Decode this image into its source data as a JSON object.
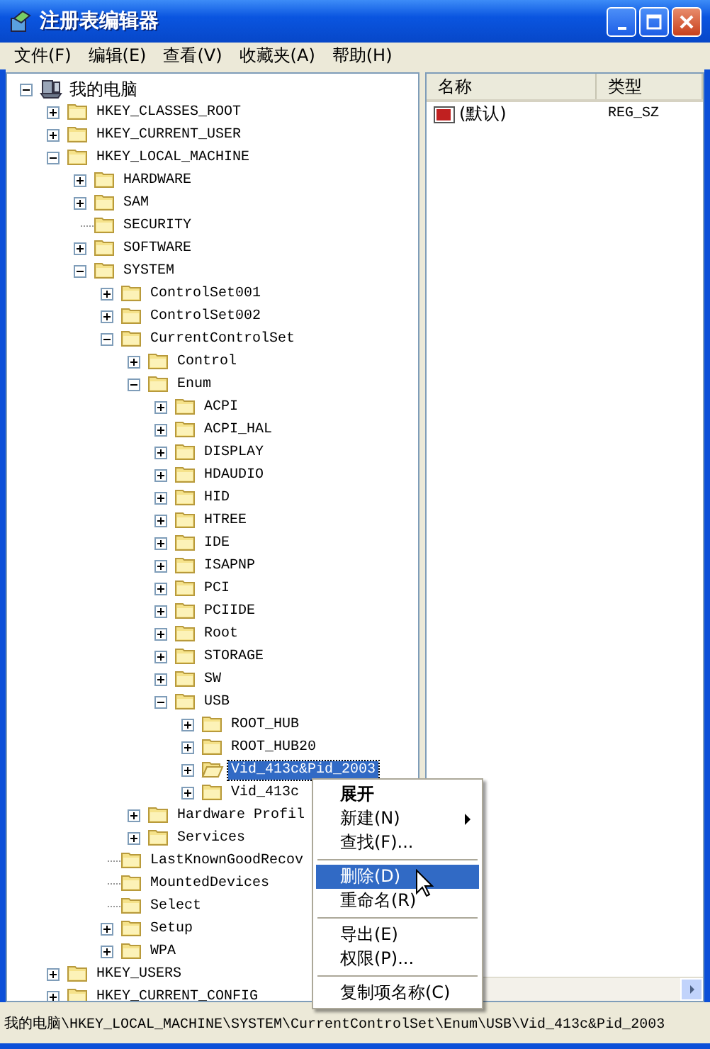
{
  "window": {
    "title": "注册表编辑器"
  },
  "menu_bar": [
    {
      "label": "文件(F)"
    },
    {
      "label": "编辑(E)"
    },
    {
      "label": "查看(V)"
    },
    {
      "label": "收藏夹(A)"
    },
    {
      "label": "帮助(H)"
    }
  ],
  "tree": [
    {
      "label": "我的电脑",
      "kind": "computer",
      "expanded": true,
      "selected": false,
      "children": [
        {
          "label": "HKEY_CLASSES_ROOT",
          "expanded": false,
          "selected": false
        },
        {
          "label": "HKEY_CURRENT_USER",
          "expanded": false,
          "selected": false
        },
        {
          "label": "HKEY_LOCAL_MACHINE",
          "expanded": true,
          "selected": false,
          "children": [
            {
              "label": "HARDWARE",
              "expanded": false,
              "selected": false
            },
            {
              "label": "SAM",
              "expanded": false,
              "selected": false
            },
            {
              "label": "SECURITY",
              "selected": false
            },
            {
              "label": "SOFTWARE",
              "expanded": false,
              "selected": false
            },
            {
              "label": "SYSTEM",
              "expanded": true,
              "selected": false,
              "children": [
                {
                  "label": "ControlSet001",
                  "expanded": false,
                  "selected": false
                },
                {
                  "label": "ControlSet002",
                  "expanded": false,
                  "selected": false
                },
                {
                  "label": "CurrentControlSet",
                  "expanded": true,
                  "selected": false,
                  "children": [
                    {
                      "label": "Control",
                      "expanded": false,
                      "selected": false
                    },
                    {
                      "label": "Enum",
                      "expanded": true,
                      "selected": false,
                      "children": [
                        {
                          "label": "ACPI",
                          "expanded": false,
                          "selected": false
                        },
                        {
                          "label": "ACPI_HAL",
                          "expanded": false,
                          "selected": false
                        },
                        {
                          "label": "DISPLAY",
                          "expanded": false,
                          "selected": false
                        },
                        {
                          "label": "HDAUDIO",
                          "expanded": false,
                          "selected": false
                        },
                        {
                          "label": "HID",
                          "expanded": false,
                          "selected": false
                        },
                        {
                          "label": "HTREE",
                          "expanded": false,
                          "selected": false
                        },
                        {
                          "label": "IDE",
                          "expanded": false,
                          "selected": false
                        },
                        {
                          "label": "ISAPNP",
                          "expanded": false,
                          "selected": false
                        },
                        {
                          "label": "PCI",
                          "expanded": false,
                          "selected": false
                        },
                        {
                          "label": "PCIIDE",
                          "expanded": false,
                          "selected": false
                        },
                        {
                          "label": "Root",
                          "expanded": false,
                          "selected": false
                        },
                        {
                          "label": "STORAGE",
                          "expanded": false,
                          "selected": false
                        },
                        {
                          "label": "SW",
                          "expanded": false,
                          "selected": false
                        },
                        {
                          "label": "USB",
                          "expanded": true,
                          "selected": false,
                          "children": [
                            {
                              "label": "ROOT_HUB",
                              "expanded": false,
                              "selected": false
                            },
                            {
                              "label": "ROOT_HUB20",
                              "expanded": false,
                              "selected": false
                            },
                            {
                              "label": "Vid_413c&Pid_2003",
                              "expanded": false,
                              "selected": true
                            },
                            {
                              "label": "Vid_413c",
                              "expanded": false,
                              "selected": false
                            }
                          ]
                        }
                      ]
                    },
                    {
                      "label": "Hardware Profil",
                      "expanded": false,
                      "selected": false
                    },
                    {
                      "label": "Services",
                      "expanded": false,
                      "selected": false
                    }
                  ]
                },
                {
                  "label": "LastKnownGoodRecov",
                  "selected": false
                },
                {
                  "label": "MountedDevices",
                  "selected": false
                },
                {
                  "label": "Select",
                  "selected": false
                },
                {
                  "label": "Setup",
                  "expanded": false,
                  "selected": false
                },
                {
                  "label": "WPA",
                  "expanded": false,
                  "selected": false
                }
              ]
            }
          ]
        },
        {
          "label": "HKEY_USERS",
          "expanded": false,
          "selected": false
        },
        {
          "label": "HKEY_CURRENT_CONFIG",
          "expanded": false,
          "selected": false
        }
      ]
    }
  ],
  "list": {
    "columns": [
      "名称",
      "类型"
    ],
    "rows": [
      {
        "name": "(默认)",
        "type": "REG_SZ"
      }
    ]
  },
  "context_menu": [
    {
      "kind": "item",
      "label": "展开",
      "default": true,
      "selected": false
    },
    {
      "kind": "submenu",
      "label": "新建(N)",
      "default": false,
      "selected": false
    },
    {
      "kind": "item",
      "label": "查找(F)...",
      "default": false,
      "selected": false
    },
    {
      "kind": "separator"
    },
    {
      "kind": "item",
      "label": "删除(D)",
      "default": false,
      "selected": true
    },
    {
      "kind": "item",
      "label": "重命名(R)",
      "default": false,
      "selected": false
    },
    {
      "kind": "separator"
    },
    {
      "kind": "item",
      "label": "导出(E)",
      "default": false,
      "selected": false
    },
    {
      "kind": "item",
      "label": "权限(P)...",
      "default": false,
      "selected": false
    },
    {
      "kind": "separator"
    },
    {
      "kind": "item",
      "label": "复制项名称(C)",
      "default": false,
      "selected": false
    }
  ],
  "status_bar": "我的电脑\\HKEY_LOCAL_MACHINE\\SYSTEM\\CurrentControlSet\\Enum\\USB\\Vid_413c&Pid_2003"
}
